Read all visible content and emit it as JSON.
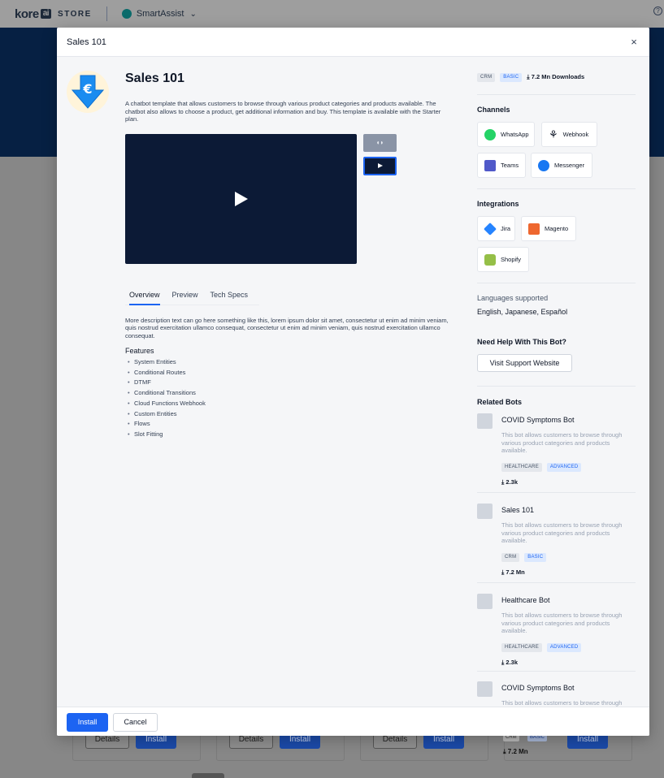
{
  "topbar": {
    "logo_text": "kore",
    "logo_ai": "ai",
    "store_label": "STORE",
    "product_name": "SmartAssist",
    "help_icon": "?"
  },
  "background": {
    "card_buttons": [
      {
        "details": "Details",
        "install": "Install"
      },
      {
        "details": "Details",
        "install": "Install"
      },
      {
        "details": "Details",
        "install": "Install"
      },
      {
        "install": "Install"
      }
    ],
    "last_card_tags": [
      "CRM",
      "BASIC"
    ],
    "last_card_downloads": "7.2 Mn"
  },
  "modal": {
    "title": "Sales 101",
    "close_icon": "×",
    "bot": {
      "name": "Sales 101",
      "description": "A chatbot template that allows customers to browse through various product categories and products available. The chatbot also allows to choose a product, get additional information and buy. This template is available with the Starter plan."
    },
    "tabs": [
      {
        "label": "Overview",
        "active": true
      },
      {
        "label": "Preview",
        "active": false
      },
      {
        "label": "Tech Specs",
        "active": false
      }
    ],
    "overview_text": "More description text can go here something like this, lorem ipsum dolor sit amet, consectetur ut enim ad minim veniam, quis nostrud exercitation ullamco consequat, consectetur ut enim ad minim veniam, quis nostrud exercitation ullamco consequat.",
    "features_heading": "Features",
    "features": [
      "System Entities",
      "Conditional Routes",
      "DTMF",
      "Conditional Transitions",
      "Cloud Functions Webhook",
      "Custom Entities",
      "Flows",
      "Slot Fitting"
    ],
    "sidebar": {
      "tags": [
        "CRM",
        "BASIC"
      ],
      "downloads": "7.2 Mn Downloads",
      "channels_heading": "Channels",
      "channels": [
        {
          "name": "WhatsApp",
          "icon": "whatsapp-icon",
          "color": "#25d366"
        },
        {
          "name": "Webhook",
          "icon": "webhook-icon",
          "color": "#101828"
        },
        {
          "name": "Teams",
          "icon": "teams-icon",
          "color": "#5059c9"
        },
        {
          "name": "Messenger",
          "icon": "messenger-icon",
          "color": "#1877f2"
        }
      ],
      "integrations_heading": "Integrations",
      "integrations": [
        {
          "name": "Jira",
          "icon": "jira-icon",
          "color": "#2684ff"
        },
        {
          "name": "Magento",
          "icon": "magento-icon",
          "color": "#ee672f"
        },
        {
          "name": "Shopify",
          "icon": "shopify-icon",
          "color": "#95bf47"
        }
      ],
      "languages_heading": "Languages supported",
      "languages": "English, Japanese, Español",
      "help_heading": "Need Help With This Bot?",
      "support_button": "Visit Support Website",
      "related_heading": "Related Bots",
      "related": [
        {
          "name": "COVID Symptoms Bot",
          "description": "This bot allows customers to browse through various product categories and products available.",
          "tags": [
            "HEALTHCARE",
            "ADVANCED"
          ],
          "downloads": "2.3k"
        },
        {
          "name": "Sales 101",
          "description": "This bot allows customers to browse through various product categories and products available.",
          "tags": [
            "CRM",
            "BASIC"
          ],
          "downloads": "7.2 Mn"
        },
        {
          "name": "Healthcare Bot",
          "description": "This bot allows customers to browse through various product categories and products available.",
          "tags": [
            "HEALTHCARE",
            "ADVANCED"
          ],
          "downloads": "2.3k"
        },
        {
          "name": "COVID Symptoms Bot",
          "description": "This bot allows customers to browse through"
        }
      ]
    },
    "footer": {
      "install": "Install",
      "cancel": "Cancel"
    }
  }
}
